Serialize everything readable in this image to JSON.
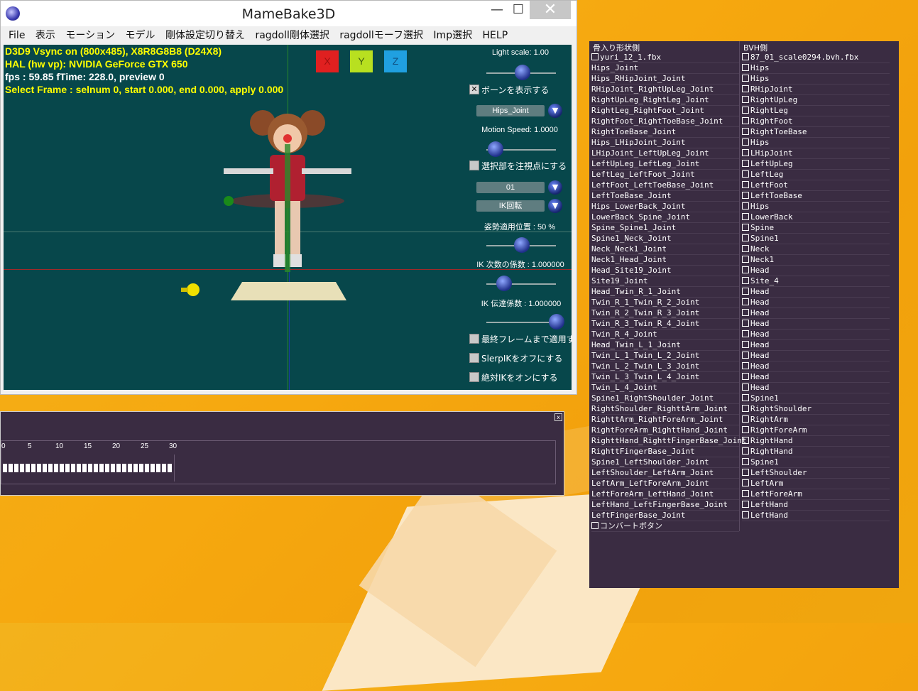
{
  "window": {
    "title": "MameBake3D",
    "minimize": "—",
    "maximize": "☐",
    "close": "✕"
  },
  "menu": [
    "File",
    "表示",
    "モーション",
    "モデル",
    "剛体設定切り替え",
    "ragdoll剛体選択",
    "ragdollモーフ選択",
    "Imp選択",
    "HELP"
  ],
  "hud": {
    "line1": "D3D9 Vsync on (800x485), X8R8G8B8 (D24X8)",
    "line2": "HAL (hw vp): NVIDIA GeForce GTX 650",
    "line3": "fps : 59.85 fTime: 228.0, preview 0",
    "line4": "Select Frame : selnum 0, start 0.000, end 0.000, apply 0.000"
  },
  "axis_buttons": {
    "x": "X",
    "y": "Y",
    "z": "Z"
  },
  "controls": {
    "light_scale": "Light scale: 1.00",
    "show_bones": "ボーンを表示する",
    "bone_dropdown": "Hips_Joint",
    "motion_speed": "Motion Speed: 1.0000",
    "focus_selected": "選択部を注視点にする",
    "dropdown_01": "01",
    "ik_mode": "IK回転",
    "pose_apply": "姿勢適用位置 : 50 %",
    "ik_order_coef": "IK 次数の係数 : 1.000000",
    "ik_transfer_coef": "IK 伝達係数 : 1.000000",
    "apply_to_last": "最終フレームまで適用する",
    "slerp_off": "SlerpIKをオフにする",
    "absolute_ik": "絶対IKをオンにする"
  },
  "timeline": {
    "ticks": [
      "0",
      "5",
      "10",
      "15",
      "20",
      "25",
      "30"
    ],
    "close": "x"
  },
  "bone_panel": {
    "left_header": "骨入り形状側",
    "right_header": "BVH側",
    "left_file": "yuri_12_1.fbx",
    "right_file": "87_01_scale0294.bvh.fbx",
    "convert_button": "コンバートボタン",
    "left": [
      "Hips_Joint",
      "Hips_RHipJoint_Joint",
      "RHipJoint_RightUpLeg_Joint",
      "RightUpLeg_RightLeg_Joint",
      "RightLeg_RightFoot_Joint",
      "RightFoot_RightToeBase_Joint",
      "RightToeBase_Joint",
      "Hips_LHipJoint_Joint",
      "LHipJoint_LeftUpLeg_Joint",
      "LeftUpLeg_LeftLeg_Joint",
      "LeftLeg_LeftFoot_Joint",
      "LeftFoot_LeftToeBase_Joint",
      "LeftToeBase_Joint",
      "Hips_LowerBack_Joint",
      "LowerBack_Spine_Joint",
      "Spine_Spine1_Joint",
      "Spine1_Neck_Joint",
      "Neck_Neck1_Joint",
      "Neck1_Head_Joint",
      "Head_Site19_Joint",
      "Site19_Joint",
      "Head_Twin_R_1_Joint",
      "Twin_R_1_Twin_R_2_Joint",
      "Twin_R_2_Twin_R_3_Joint",
      "Twin_R_3_Twin_R_4_Joint",
      "Twin_R_4_Joint",
      "Head_Twin_L_1_Joint",
      "Twin_L_1_Twin_L_2_Joint",
      "Twin_L_2_Twin_L_3_Joint",
      "Twin_L_3_Twin_L_4_Joint",
      "Twin_L_4_Joint",
      "Spine1_RightShoulder_Joint",
      "RightShoulder_RighttArm_Joint",
      "RighttArm_RightForeArm_Joint",
      "RightForeArm_RighttHand_Joint",
      "RighttHand_RighttFingerBase_Joint",
      "RighttFingerBase_Joint",
      "Spine1_LeftShoulder_Joint",
      "LeftShoulder_LeftArm_Joint",
      "LeftArm_LeftForeArm_Joint",
      "LeftForeArm_LeftHand_Joint",
      "LeftHand_LeftFingerBase_Joint",
      "LeftFingerBase_Joint"
    ],
    "right": [
      "Hips",
      "Hips",
      "RHipJoint",
      "RightUpLeg",
      "RightLeg",
      "RightFoot",
      "RightToeBase",
      "Hips",
      "LHipJoint",
      "LeftUpLeg",
      "LeftLeg",
      "LeftFoot",
      "LeftToeBase",
      "Hips",
      "LowerBack",
      "Spine",
      "Spine1",
      "Neck",
      "Neck1",
      "Head",
      "Site_4",
      "Head",
      "Head",
      "Head",
      "Head",
      "Head",
      "Head",
      "Head",
      "Head",
      "Head",
      "Head",
      "Spine1",
      "RightShoulder",
      "RightArm",
      "RightForeArm",
      "RightHand",
      "RightHand",
      "Spine1",
      "LeftShoulder",
      "LeftArm",
      "LeftForeArm",
      "LeftHand",
      "LeftHand"
    ]
  }
}
